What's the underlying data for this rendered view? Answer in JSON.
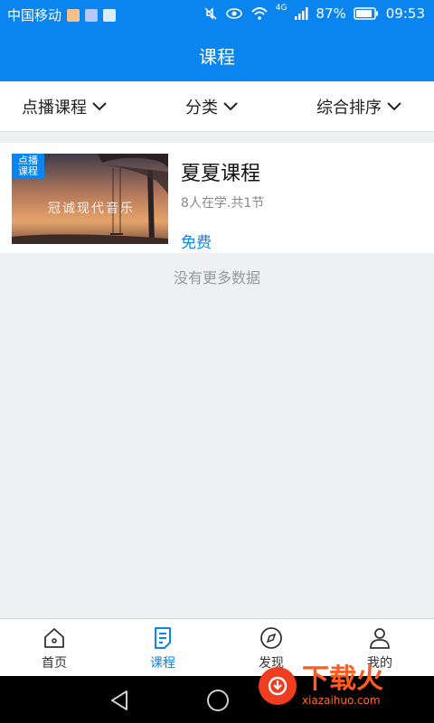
{
  "status": {
    "carrier": "中国移动",
    "network": "4G",
    "battery": "87%",
    "time": "09:53"
  },
  "header": {
    "title": "课程"
  },
  "filters": [
    {
      "label": "点播课程"
    },
    {
      "label": "分类"
    },
    {
      "label": "综合排序"
    }
  ],
  "course": {
    "badge": "点播\n课程",
    "thumb_text": "冠诚现代音乐",
    "title": "夏夏课程",
    "meta": "8人在学.共1节",
    "price": "免费"
  },
  "list": {
    "end_text": "没有更多数据"
  },
  "tabs": [
    {
      "label": "首页",
      "icon": "home-icon"
    },
    {
      "label": "课程",
      "icon": "course-icon",
      "active": true
    },
    {
      "label": "发现",
      "icon": "compass-icon"
    },
    {
      "label": "我的",
      "icon": "user-icon"
    }
  ],
  "watermark": {
    "main": "下载火",
    "sub": "xiazaihuo.com"
  },
  "colors": {
    "accent": "#0a85f0"
  }
}
